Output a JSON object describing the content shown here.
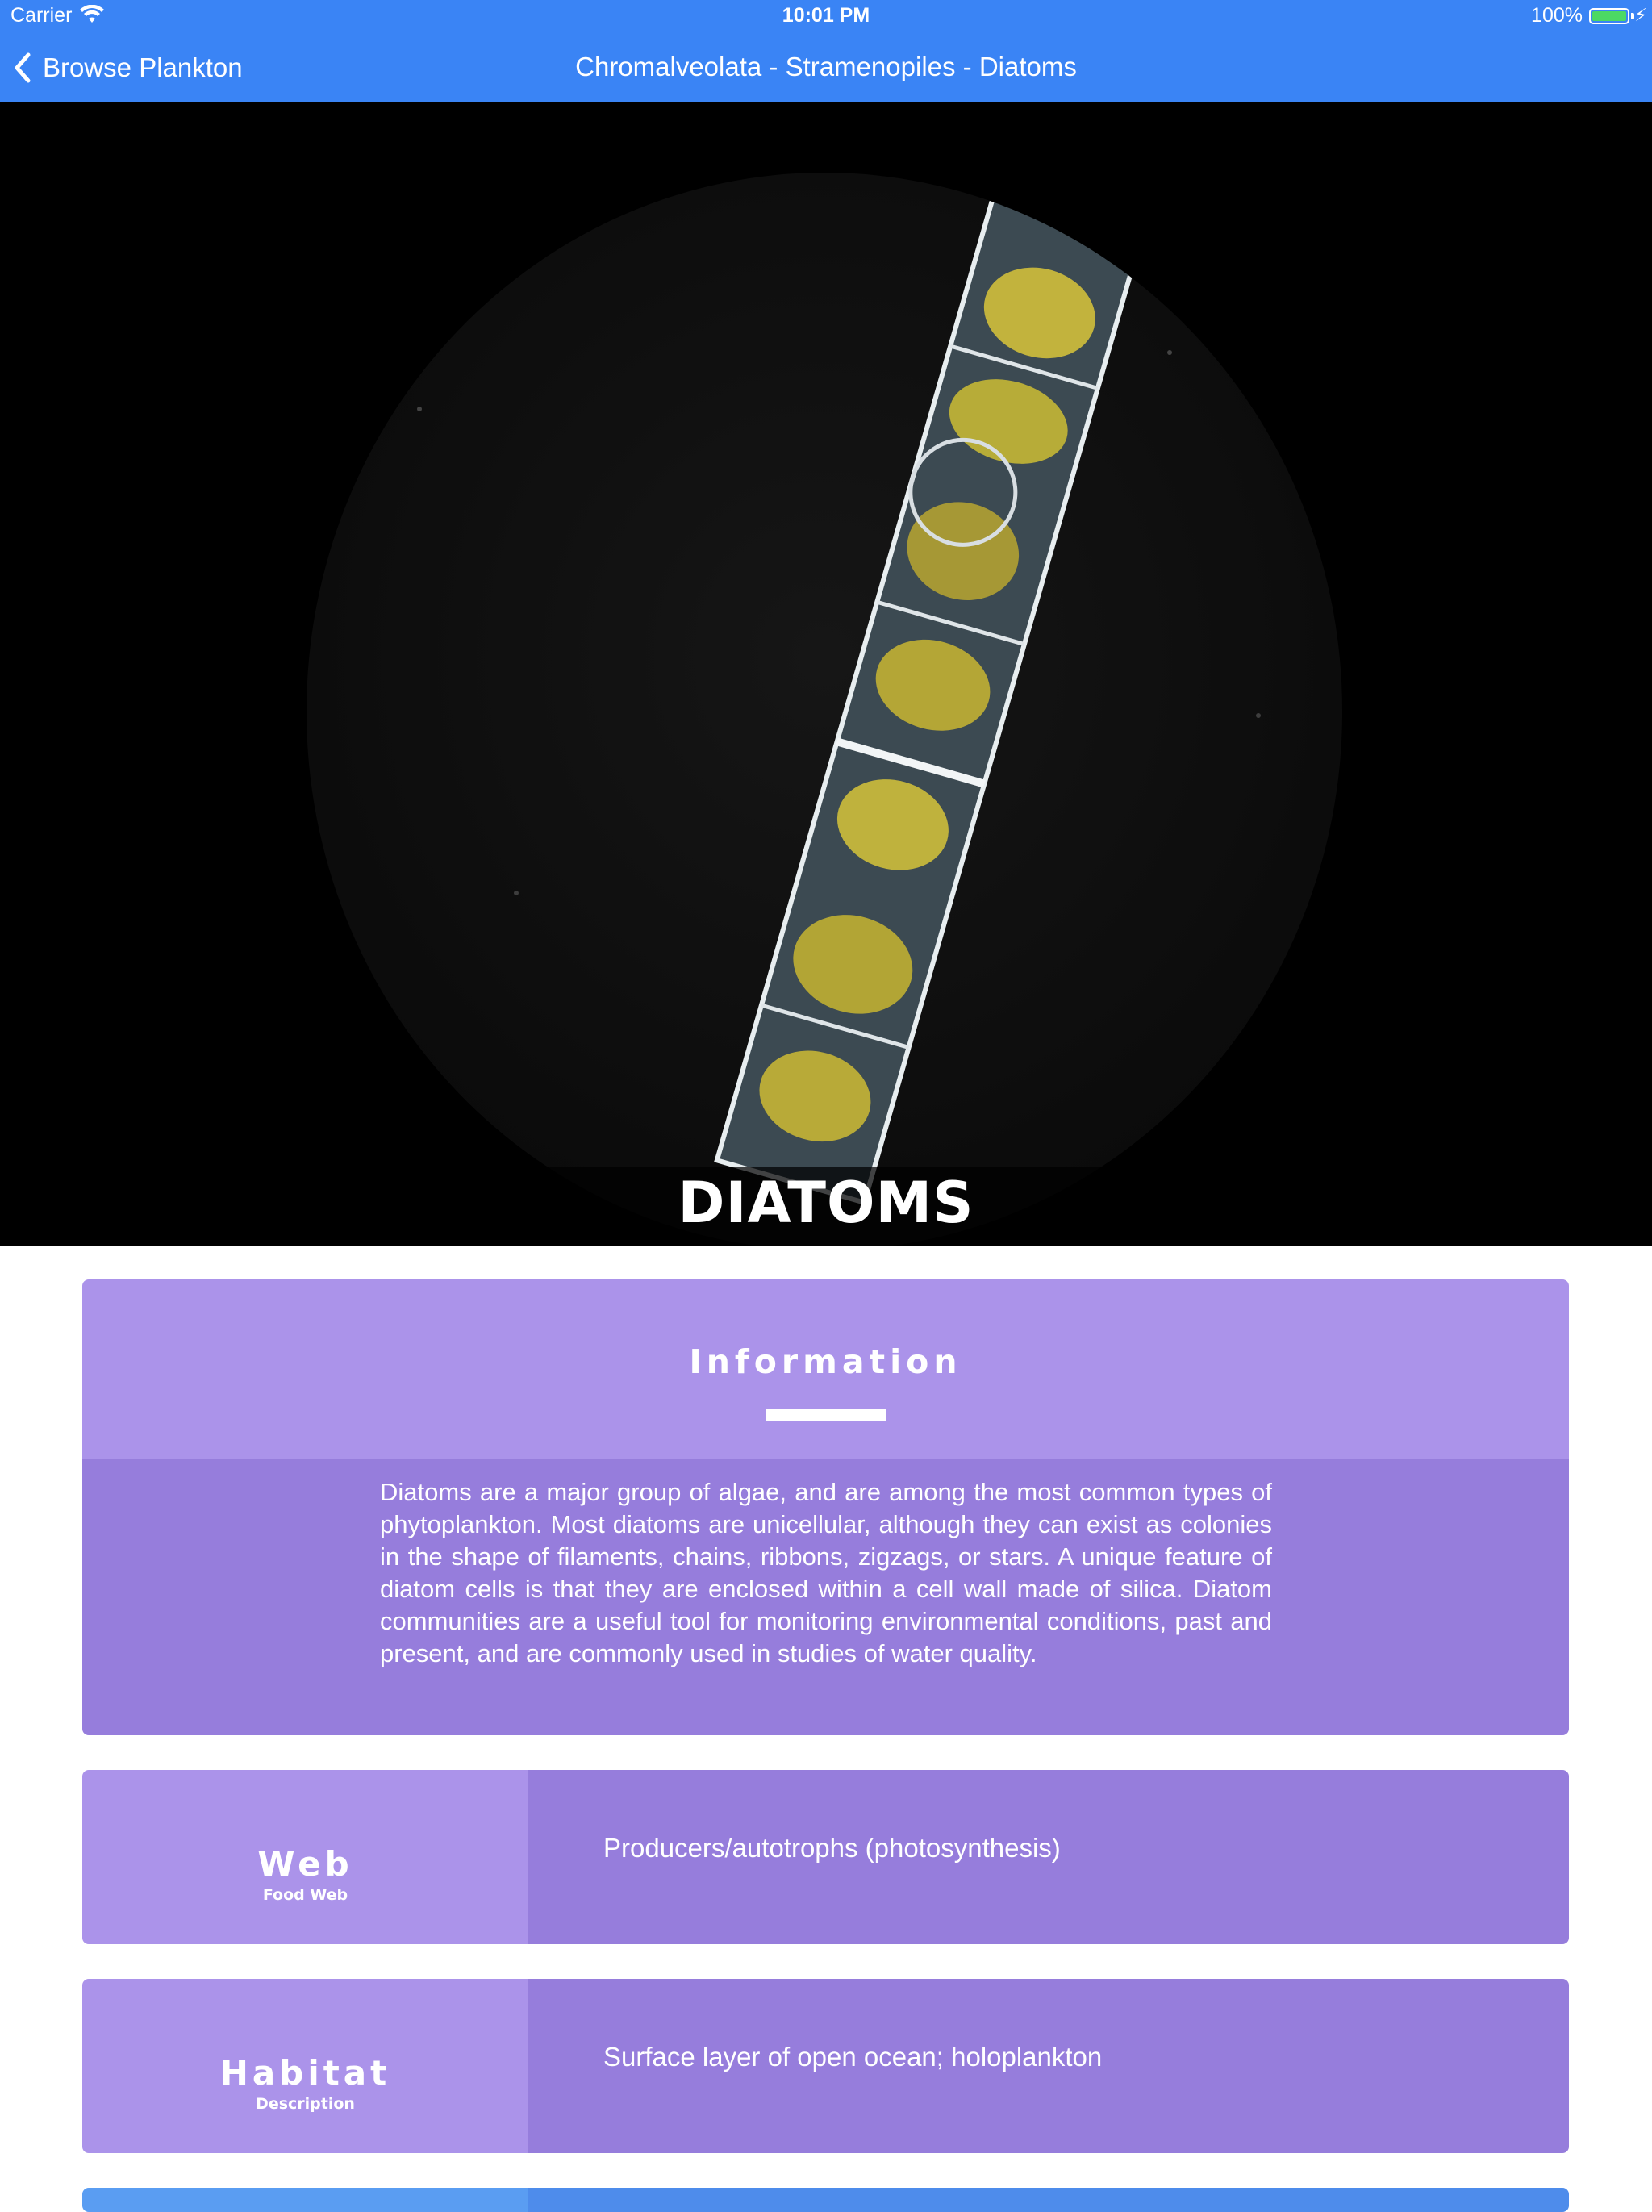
{
  "status_bar": {
    "carrier": "Carrier",
    "time": "10:01 PM",
    "battery": "100%"
  },
  "nav": {
    "back_label": "Browse Plankton",
    "title": "Chromalveolata - Stramenopiles - Diatoms"
  },
  "hero": {
    "title": "DIATOMS"
  },
  "information": {
    "title": "Information",
    "text": "Diatoms are a major group of algae, and are among the most common types of phytoplankton. Most diatoms are unicellular, although they can exist as colonies in the shape of filaments, chains, ribbons, zigzags, or stars. A unique feature of diatom cells is that they are enclosed within a cell wall made of silica. Diatom communities are a useful tool for monitoring environmental conditions, past and present, and are commonly used in studies of water quality."
  },
  "rows": [
    {
      "title": "Web",
      "subtitle": "Food Web",
      "text": "Producers/autotrophs (photosynthesis)"
    },
    {
      "title": "Habitat",
      "subtitle": "Description",
      "text": "Surface layer of open ocean; holoplankton"
    }
  ],
  "colors": {
    "nav_blue": "#3a84f5",
    "card_light": "#ab93ea",
    "card_dark": "#967ddc"
  }
}
